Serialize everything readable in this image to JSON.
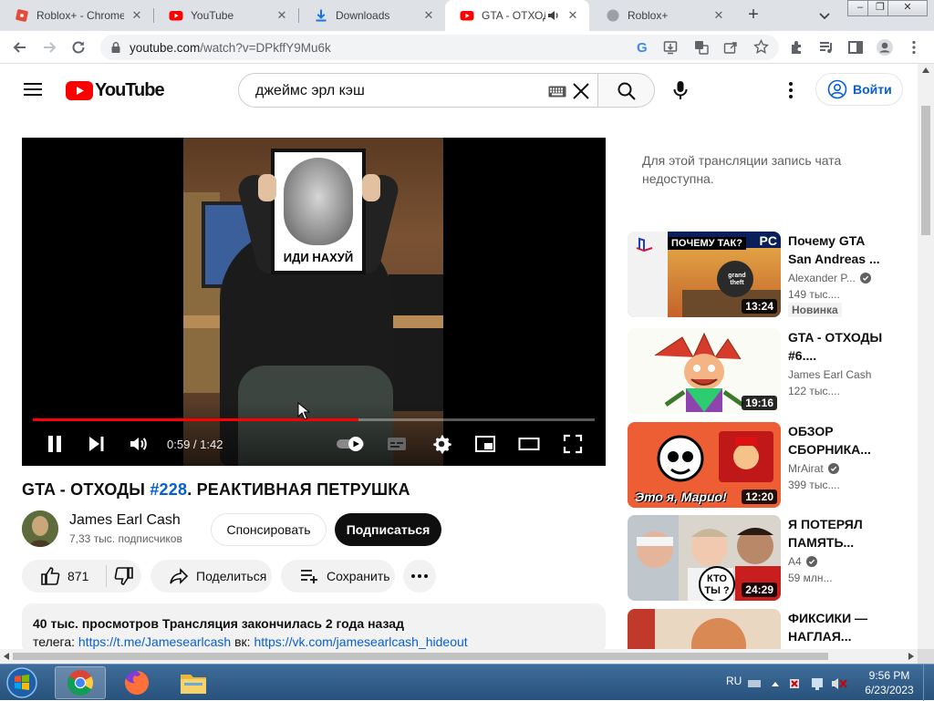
{
  "browser": {
    "tabs": [
      {
        "title": "Roblox+ - Chrome",
        "icon": "roblox-plus-icon"
      },
      {
        "title": "YouTube",
        "icon": "youtube-icon"
      },
      {
        "title": "Downloads",
        "icon": "download-icon"
      },
      {
        "title": "GTA - ОТХОД",
        "icon": "youtube-icon",
        "active": true,
        "audio": true
      },
      {
        "title": "Roblox+",
        "icon": "roblox-plus-icon"
      }
    ],
    "url_host": "youtube.com",
    "url_path": "/watch?v=DPkffY9Mu6k"
  },
  "header": {
    "logo_text": "YouTube",
    "search_value": "джеймс эрл кэш",
    "signin_label": "Войти"
  },
  "player": {
    "current_time": "0:59",
    "duration": "1:42",
    "played_fraction": 0.58,
    "buffered_fraction": 0.58,
    "overlay_caption": "ИДИ НАХУЙ"
  },
  "video": {
    "title_prefix": "GTA - ОТХОДЫ ",
    "title_hashtag": "#228",
    "title_suffix": ". РЕАКТИВНАЯ ПЕТРУШКА",
    "channel": "James Earl Cash",
    "subscribers": "7,33 тыс. подписчиков",
    "sponsor_label": "Спонсировать",
    "subscribe_label": "Подписаться",
    "likes": "871",
    "share_label": "Поделиться",
    "save_label": "Сохранить",
    "desc_stats": "40 тыс. просмотров  Трансляция закончилась 2 года назад",
    "desc_line2_label1": "телега:",
    "desc_line2_link1": "https://t.me/Jamesearlcash",
    "desc_line2_label2": "вк:",
    "desc_line2_link2": "https://vk.com/jamesearlcash_hideout"
  },
  "chat_unavailable": "Для этой трансляции запись чата недоступна.",
  "recommendations": [
    {
      "title": "Почему GTA San Andreas ...",
      "channel": "Alexander P...",
      "verified": true,
      "views": "149 тыс....",
      "duration": "13:24",
      "badge": "Новинка",
      "thumb_text": "ПОЧЕМУ ТАК?",
      "thumb_corner": "PC"
    },
    {
      "title": "GTA - ОТХОДЫ #6....",
      "channel": "James Earl Cash",
      "verified": false,
      "views": "122 тыс....",
      "duration": "19:16"
    },
    {
      "title": "ОБЗОР СБОРНИКА...",
      "channel": "MrAirat",
      "verified": true,
      "views": "399 тыс....",
      "duration": "12:20",
      "thumb_text": "Это я, Марио!"
    },
    {
      "title": "Я ПОТЕРЯЛ ПАМЯТЬ...",
      "channel": "A4",
      "verified": true,
      "views": "59 млн...",
      "duration": "24:29",
      "thumb_text": "КТО ТЫ ?"
    },
    {
      "title": "ФИКСИКИ — НАГЛАЯ..."
    }
  ],
  "taskbar": {
    "lang": "RU",
    "time": "9:56 PM",
    "date": "6/23/2023"
  },
  "colors": {
    "youtube_red": "#ff0000",
    "link_blue": "#065fd4",
    "progress_red": "#ff0000",
    "taskbar": "#2f5d8a"
  }
}
